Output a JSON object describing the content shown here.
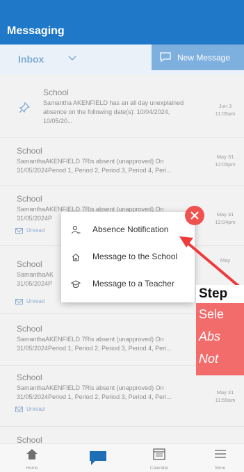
{
  "app": {
    "title": "Messaging"
  },
  "toolbar": {
    "folder": "Inbox",
    "new_message": "New Message"
  },
  "messages": [
    {
      "sender": "School",
      "body": [
        "Samantha AKENFIELD has an all day unexplained",
        "absence on the following date(s): 10/04/2024,",
        "10/05/20..."
      ],
      "date": [
        "Jun 3",
        "11:05am"
      ],
      "pinned": true,
      "unread": false
    },
    {
      "sender": "School",
      "body": [
        "SamanthaAKENFIELD 7Ris absent (unapproved) On",
        "31/05/2024Period 1, Period 2, Period 3, Period 4, Peri..."
      ],
      "date": [
        "May 31",
        "12:05pm"
      ],
      "pinned": false,
      "unread": false
    },
    {
      "sender": "School",
      "body": [
        "SamanthaAKENFIELD 7Ris absent (unapproved) On",
        "31/05/2024P"
      ],
      "date": [
        "May 31",
        "12:04pm"
      ],
      "pinned": false,
      "unread": true
    },
    {
      "sender": "School",
      "body": [
        "SamanthaAK",
        "31/05/2024P"
      ],
      "date": [
        "May",
        ""
      ],
      "pinned": false,
      "unread": true
    },
    {
      "sender": "School",
      "body": [
        "SamanthaAKENFIELD 7Ris absent (unapproved) On",
        "31/05/2024Period 1, Period 2, Period 3, Period 4, Peri..."
      ],
      "date": [
        "",
        ""
      ],
      "pinned": false,
      "unread": false
    },
    {
      "sender": "School",
      "body": [
        "SamanthaAKENFIELD 7Ris absent (unapproved) On",
        "31/05/2024Period 1, Period 2, Period 3, Period 4, Peri..."
      ],
      "date": [
        "May 31",
        "11:59am"
      ],
      "pinned": false,
      "unread": true
    },
    {
      "sender": "School",
      "body": [],
      "date": [
        "",
        ""
      ],
      "pinned": false,
      "unread": false
    }
  ],
  "unread_label": "Unread",
  "popup": {
    "items": [
      {
        "label": "Absence Notification",
        "icon": "person-add-icon"
      },
      {
        "label": "Message to the School",
        "icon": "home-icon"
      },
      {
        "label": "Message to a Teacher",
        "icon": "graduation-cap-icon"
      }
    ]
  },
  "callout": {
    "step": "Step",
    "lines": [
      "Sele",
      "Abs",
      "Not"
    ]
  },
  "bottom_nav": [
    {
      "label": "Home",
      "icon": "home-icon"
    },
    {
      "label": "",
      "icon": "chat-icon"
    },
    {
      "label": "Calendar",
      "icon": "calendar-icon"
    },
    {
      "label": "More",
      "icon": "menu-icon"
    }
  ],
  "colors": {
    "brand": "#1f78c8",
    "accent_red": "#ef5350",
    "callout": "#f26c6c"
  }
}
